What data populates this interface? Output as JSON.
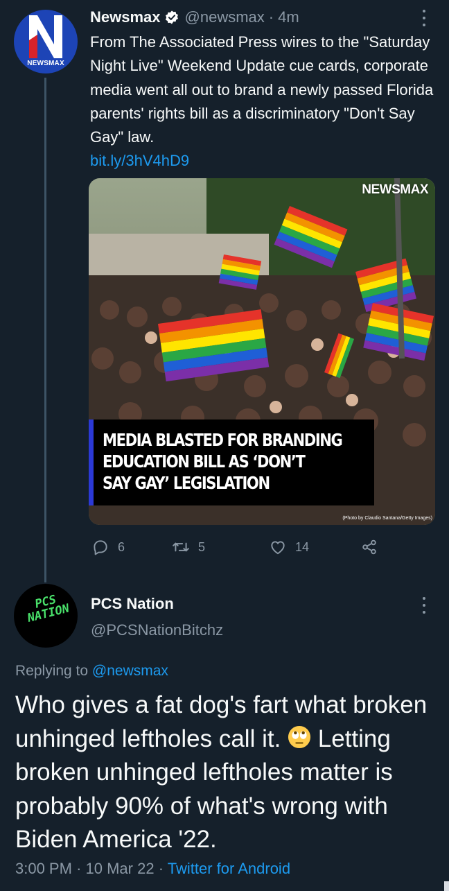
{
  "tweet": {
    "avatar_text": "NEWSMAX",
    "name": "Newsmax",
    "handle": "@newsmax",
    "separator": "·",
    "time": "4m",
    "text": "From The Associated Press wires to the \"Saturday Night Live\" Weekend Update cue cards, corporate media went all out to brand a newly passed Florida parents' rights bill as a discriminatory \"Don't Say Gay\" law.",
    "link": "bit.ly/3hV4hD9",
    "media": {
      "brand": "NEWSMAX",
      "headline_lines": [
        "MEDIA BLASTED FOR BRANDING",
        "EDUCATION BILL AS ‘DON’T",
        "SAY GAY’ LEGISLATION"
      ],
      "credit": "(Photo by Claudio Santana/Getty Images)"
    },
    "actions": {
      "replies": "6",
      "retweets": "5",
      "likes": "14"
    },
    "icons": [
      "verified-badge-icon",
      "more-icon",
      "reply-icon",
      "retweet-icon",
      "like-icon",
      "share-icon"
    ]
  },
  "reply": {
    "avatar_text": [
      "PCS",
      "NATION"
    ],
    "name": "PCS Nation",
    "handle": "@PCSNationBitchz",
    "replying_prefix": "Replying to",
    "replying_to": "@newsmax",
    "text_before_emoji": "Who gives a fat dog's fart what broken unhinged leftholes call it.",
    "emoji": "face-with-rolling-eyes",
    "text_after_emoji": "Letting broken unhinged leftholes matter is probably 90% of what's wrong with Biden America '22.",
    "time": "3:00 PM",
    "separator1": "·",
    "date": "10 Mar 22",
    "separator2": "·",
    "client": "Twitter for Android"
  },
  "colors": {
    "background": "#15202b",
    "text": "#f7f9f9",
    "secondary": "#8b98a5",
    "accent": "#1d9bf0",
    "newsmax_blue": "#1d44b6",
    "pcs_green": "#49e06a"
  }
}
